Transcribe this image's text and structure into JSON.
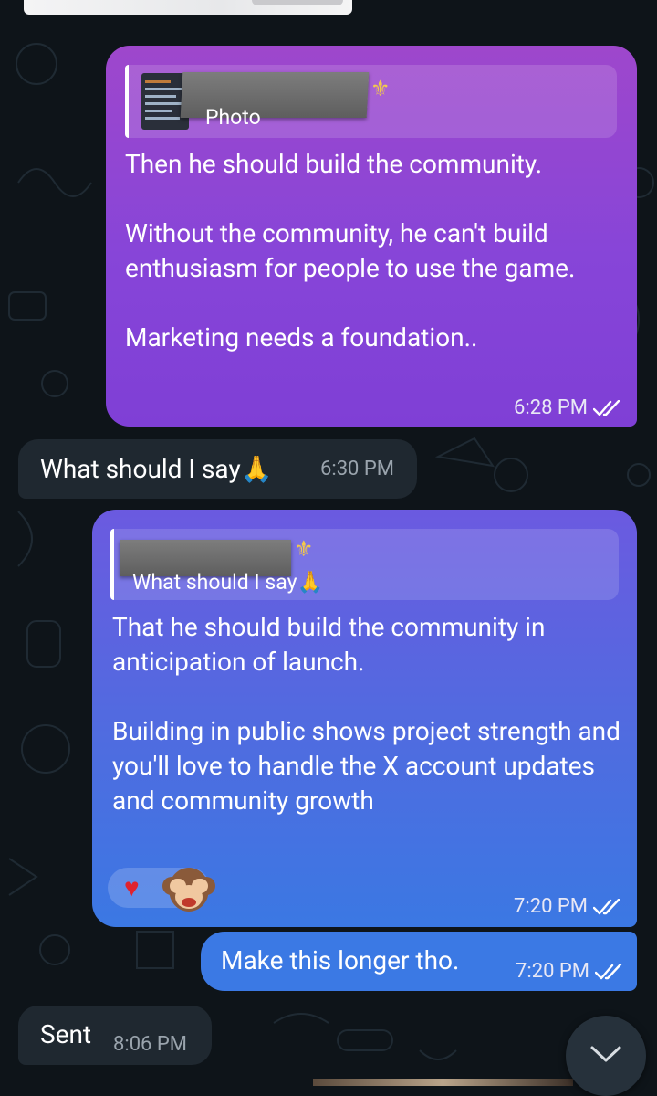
{
  "messages": [
    {
      "id": "m1",
      "direction": "outgoing",
      "reply_preview": {
        "label": "Photo"
      },
      "text": "Then he should build the community.\n\nWithout the community, he can't build enthusiasm for people to use the game.\n\nMarketing needs a foundation..",
      "time": "6:28 PM",
      "status": "read"
    },
    {
      "id": "m2",
      "direction": "incoming",
      "text": "What should I say",
      "emoji": "🙏",
      "time": "6:30 PM"
    },
    {
      "id": "m3",
      "direction": "outgoing",
      "reply_preview": {
        "label": "What should I say",
        "emoji": "🙏"
      },
      "text": "That he should build the community in anticipation of launch.\n\nBuilding in public shows project strength and you'll love to handle the X account updates and community growth",
      "reactions": [
        "heart",
        "see-no-evil-monkey"
      ],
      "time": "7:20 PM",
      "status": "read"
    },
    {
      "id": "m4",
      "direction": "outgoing",
      "text": "Make this longer tho.",
      "time": "7:20 PM",
      "status": "read"
    },
    {
      "id": "m5",
      "direction": "incoming",
      "text": "Sent",
      "time": "8:06 PM"
    }
  ],
  "icons": {
    "status_read": "double-check-icon",
    "scroll_down": "chevron-down-icon",
    "reply_badge": "fleur-de-lis-icon"
  },
  "colors": {
    "background": "#0e1419",
    "incoming_bubble": "#1f2830",
    "outgoing_purple": "#8745d8",
    "outgoing_blue": "#3b79e4"
  }
}
